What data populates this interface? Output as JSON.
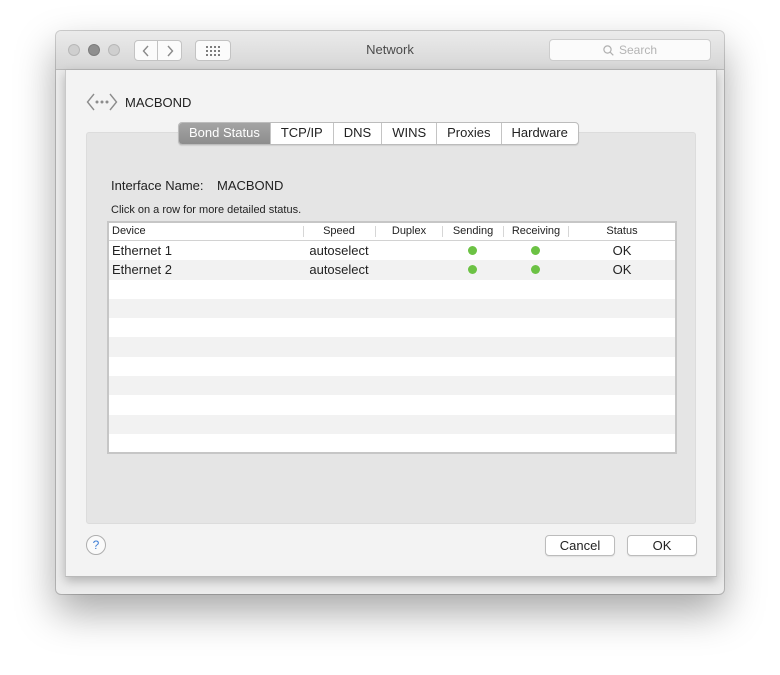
{
  "window": {
    "title": "Network"
  },
  "search": {
    "placeholder": "Search"
  },
  "interface": {
    "name": "MACBOND"
  },
  "tabs": [
    {
      "label": "Bond Status",
      "active": true
    },
    {
      "label": "TCP/IP"
    },
    {
      "label": "DNS"
    },
    {
      "label": "WINS"
    },
    {
      "label": "Proxies"
    },
    {
      "label": "Hardware"
    }
  ],
  "bond": {
    "interface_label": "Interface Name:",
    "interface_value": "MACBOND",
    "hint": "Click on a row for more detailed status."
  },
  "table": {
    "columns": [
      "Device",
      "Speed",
      "Duplex",
      "Sending",
      "Receiving",
      "Status"
    ],
    "rows": [
      {
        "device": "Ethernet 1",
        "speed": "autoselect",
        "duplex": "",
        "sending": "active",
        "receiving": "active",
        "status": "OK"
      },
      {
        "device": "Ethernet 2",
        "speed": "autoselect",
        "duplex": "",
        "sending": "active",
        "receiving": "active",
        "status": "OK"
      }
    ],
    "indicator_color": "#6cc244"
  },
  "buttons": {
    "help": "?",
    "cancel": "Cancel",
    "ok": "OK"
  }
}
